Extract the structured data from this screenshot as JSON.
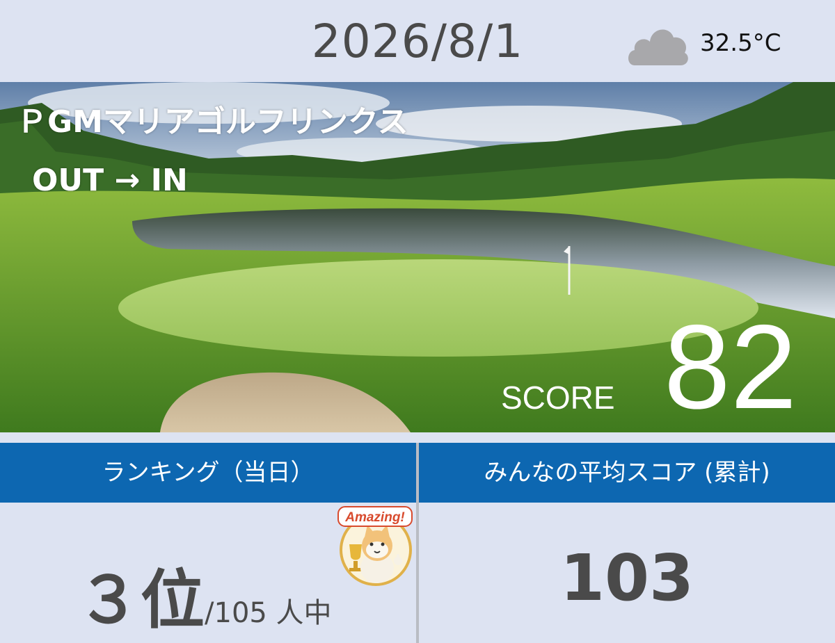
{
  "header": {
    "date": "2026/8/1",
    "weather_icon": "cloud-icon",
    "temperature": "32.5°C"
  },
  "hero": {
    "course_name": "ＰGMマリアゴルフリンクス",
    "route": "OUT → IN",
    "score_label": "SCORE",
    "score_value": "82"
  },
  "ranking": {
    "title": "ランキング（当日）",
    "rank": "３位",
    "total": "/105 人中",
    "badge_text": "Amazing!"
  },
  "average": {
    "title": "みんなの平均スコア (累計)",
    "value": "103"
  },
  "colors": {
    "header_bg": "#dde3f2",
    "panel_header_bg": "#0d67b1",
    "text_dark": "#4a4a4a"
  }
}
